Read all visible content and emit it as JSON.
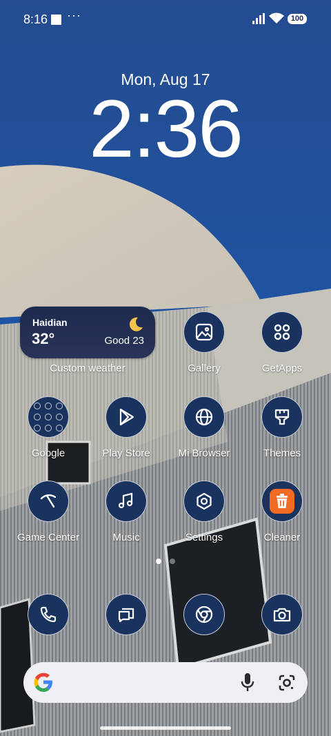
{
  "status_bar": {
    "time": "8:16",
    "more": "···",
    "battery": "100"
  },
  "lockscreen": {
    "date": "Mon, Aug 17",
    "clock": "2:36"
  },
  "weather_widget": {
    "city": "Haidian",
    "temperature": "32°",
    "air_quality": "Good 23",
    "condition_icon": "moon-icon",
    "label": "Custom weather"
  },
  "apps": {
    "gallery": "Gallery",
    "getapps": "GetApps",
    "google": "Google",
    "play_store": "Play Store",
    "mi_browser": "Mi Browser",
    "themes": "Themes",
    "game_center": "Game Center",
    "music": "Music",
    "settings": "Settings",
    "cleaner": "Cleaner"
  },
  "dock": [
    "phone-icon",
    "messages-icon",
    "chrome-icon",
    "camera-icon"
  ],
  "page_indicator": {
    "pages": 2,
    "active": 1
  },
  "search_bar": {
    "logo": "google-logo-icon",
    "voice": "mic-icon",
    "lens": "lens-icon"
  },
  "colors": {
    "icon_bg": "#19335e",
    "cleaner_accent": "#f36a22",
    "widget_bg": "#1e2a4e",
    "sky": "#1f4f9a"
  }
}
